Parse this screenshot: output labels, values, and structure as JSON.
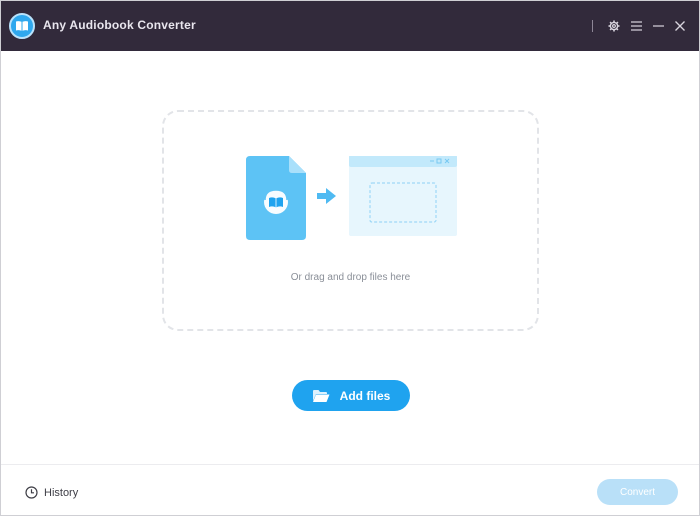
{
  "app": {
    "title": "Any Audiobook Converter"
  },
  "titlebar": {
    "icons": [
      "settings-icon",
      "menu-icon",
      "minimize-icon",
      "close-icon"
    ]
  },
  "drop_zone": {
    "hint": "Or drag and drop files here"
  },
  "add_files": {
    "label": "Add files"
  },
  "footer": {
    "history_label": "History",
    "convert_label": "Convert"
  },
  "colors": {
    "titlebar": "#322a3b",
    "accent": "#1fa3ef",
    "convert_disabled": "#b9e0f8",
    "dashed_border": "#e2e4e8"
  }
}
